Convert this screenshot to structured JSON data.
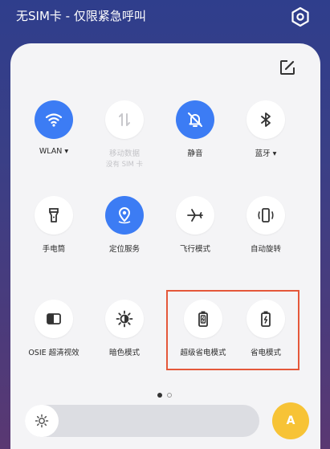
{
  "status_bar": {
    "carrier_text": "无SIM卡 - 仅限紧急呼叫",
    "settings_icon": "gear-icon"
  },
  "panel": {
    "edit_icon": "edit-icon",
    "tiles": [
      {
        "label": "WLAN ▾",
        "icon": "wifi-icon",
        "state": "on"
      },
      {
        "label": "移动数据",
        "sublabel": "没有 SIM 卡",
        "icon": "mobile-data-icon",
        "state": "disabled"
      },
      {
        "label": "静音",
        "icon": "bell-mute-icon",
        "state": "on"
      },
      {
        "label": "蓝牙 ▾",
        "icon": "bluetooth-icon",
        "state": "off"
      },
      {
        "label": "手电筒",
        "icon": "flashlight-icon",
        "state": "off"
      },
      {
        "label": "定位服务",
        "icon": "location-icon",
        "state": "on"
      },
      {
        "label": "飞行模式",
        "icon": "airplane-icon",
        "state": "off"
      },
      {
        "label": "自动旋转",
        "icon": "auto-rotate-icon",
        "state": "off"
      },
      {
        "label": "OSIE 超清视效",
        "icon": "osie-icon",
        "state": "off"
      },
      {
        "label": "暗色模式",
        "icon": "dark-mode-icon",
        "state": "off"
      },
      {
        "label": "超级省电模式",
        "icon": "super-power-saving-icon",
        "state": "off"
      },
      {
        "label": "省电模式",
        "icon": "power-saving-icon",
        "state": "off"
      }
    ],
    "page_indicator": {
      "current": 1,
      "total": 2
    },
    "brightness": {
      "level": 0.05,
      "icon": "brightness-icon",
      "auto_label": "A"
    },
    "highlight_color": "#e5583a",
    "accent_color": "#3c7cf4"
  }
}
